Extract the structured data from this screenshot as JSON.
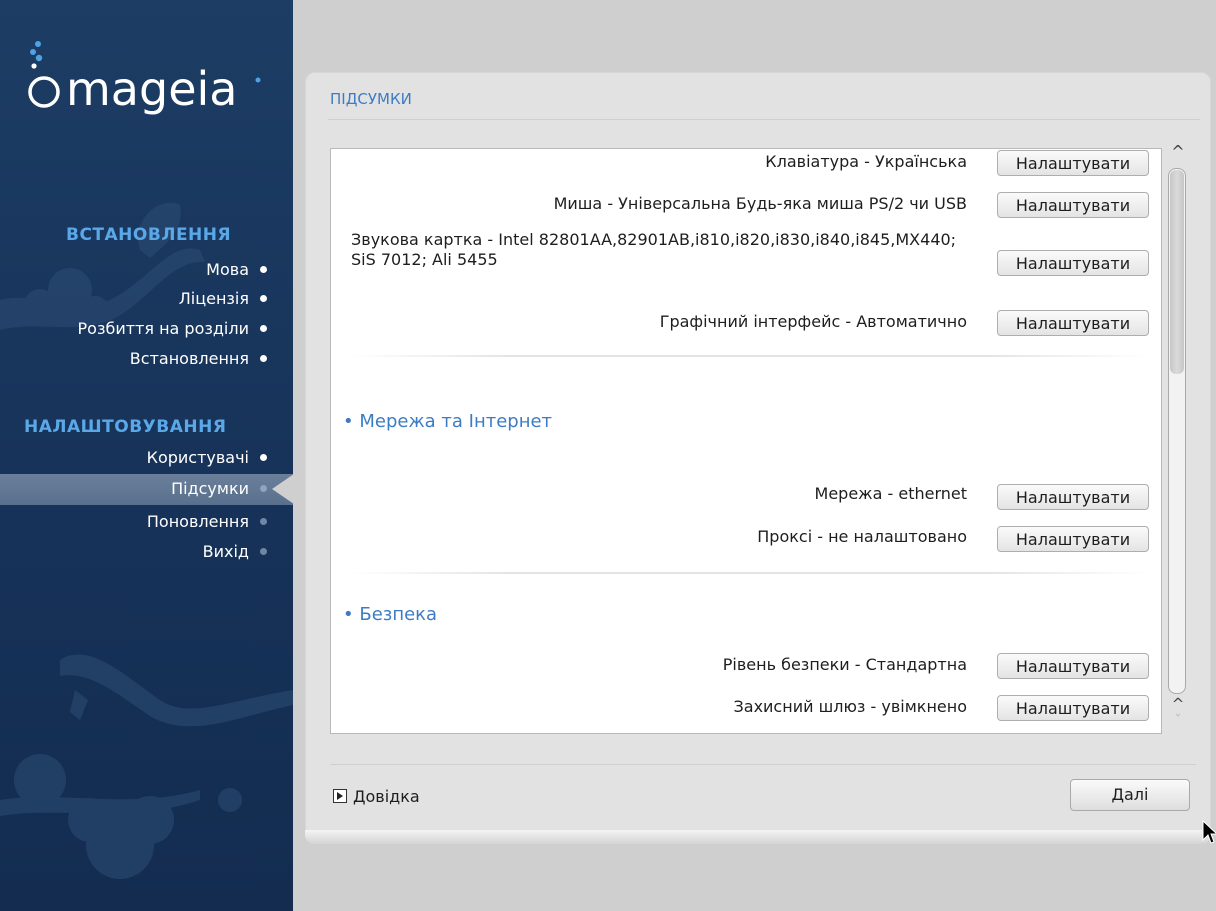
{
  "brand": {
    "logo_text": "mageia"
  },
  "sidebar": {
    "sections": [
      {
        "title": "ВСТАНОВЛЕННЯ",
        "steps": [
          {
            "label": "Мова",
            "state": "done"
          },
          {
            "label": "Ліцензія",
            "state": "done"
          },
          {
            "label": "Розбиття на розділи",
            "state": "done"
          },
          {
            "label": "Встановлення",
            "state": "done"
          }
        ]
      },
      {
        "title": "НАЛАШТОВУВАННЯ",
        "steps": [
          {
            "label": "Користувачі",
            "state": "done"
          },
          {
            "label": "Підсумки",
            "state": "current"
          },
          {
            "label": "Поновлення",
            "state": "pending"
          },
          {
            "label": "Вихід",
            "state": "pending"
          }
        ]
      }
    ]
  },
  "main": {
    "title": "ПІДСУМКИ",
    "configure_label": "Налаштувати",
    "items": [
      {
        "label": "Клавіатура - Українська"
      },
      {
        "label": "Миша - Універсальна Будь-яка миша PS/2 чи USB"
      },
      {
        "label": "Звукова картка - Intel 82801AA,82901AB,i810,i820,i830,i840,i845,MX440; SiS 7012; Ali 5455"
      },
      {
        "label": "Графічний інтерфейс - Автоматично"
      }
    ],
    "sections": [
      {
        "title": "• Мережа та Інтернет",
        "items": [
          {
            "label": "Мережа - ethernet"
          },
          {
            "label": "Проксі - не налаштовано"
          }
        ]
      },
      {
        "title": "• Безпека",
        "items": [
          {
            "label": "Рівень безпеки - Стандартна"
          },
          {
            "label": "Захисний шлюз - увімкнено"
          }
        ]
      }
    ],
    "scroll": {
      "position_fraction": 0.38
    }
  },
  "footer": {
    "help_label": "Довідка",
    "next_label": "Далі"
  },
  "colors": {
    "sidebar_bg": "#17335a",
    "accent": "#3d7cc4",
    "sidebar_section_title": "#5aa8e8",
    "current_step_band": "#627894"
  },
  "icons": {
    "help_toggle": "triangle-right-icon",
    "scroll_up": "chevron-up-icon",
    "scroll_down": "chevron-down-icon",
    "cursor": "mouse-pointer-icon"
  }
}
